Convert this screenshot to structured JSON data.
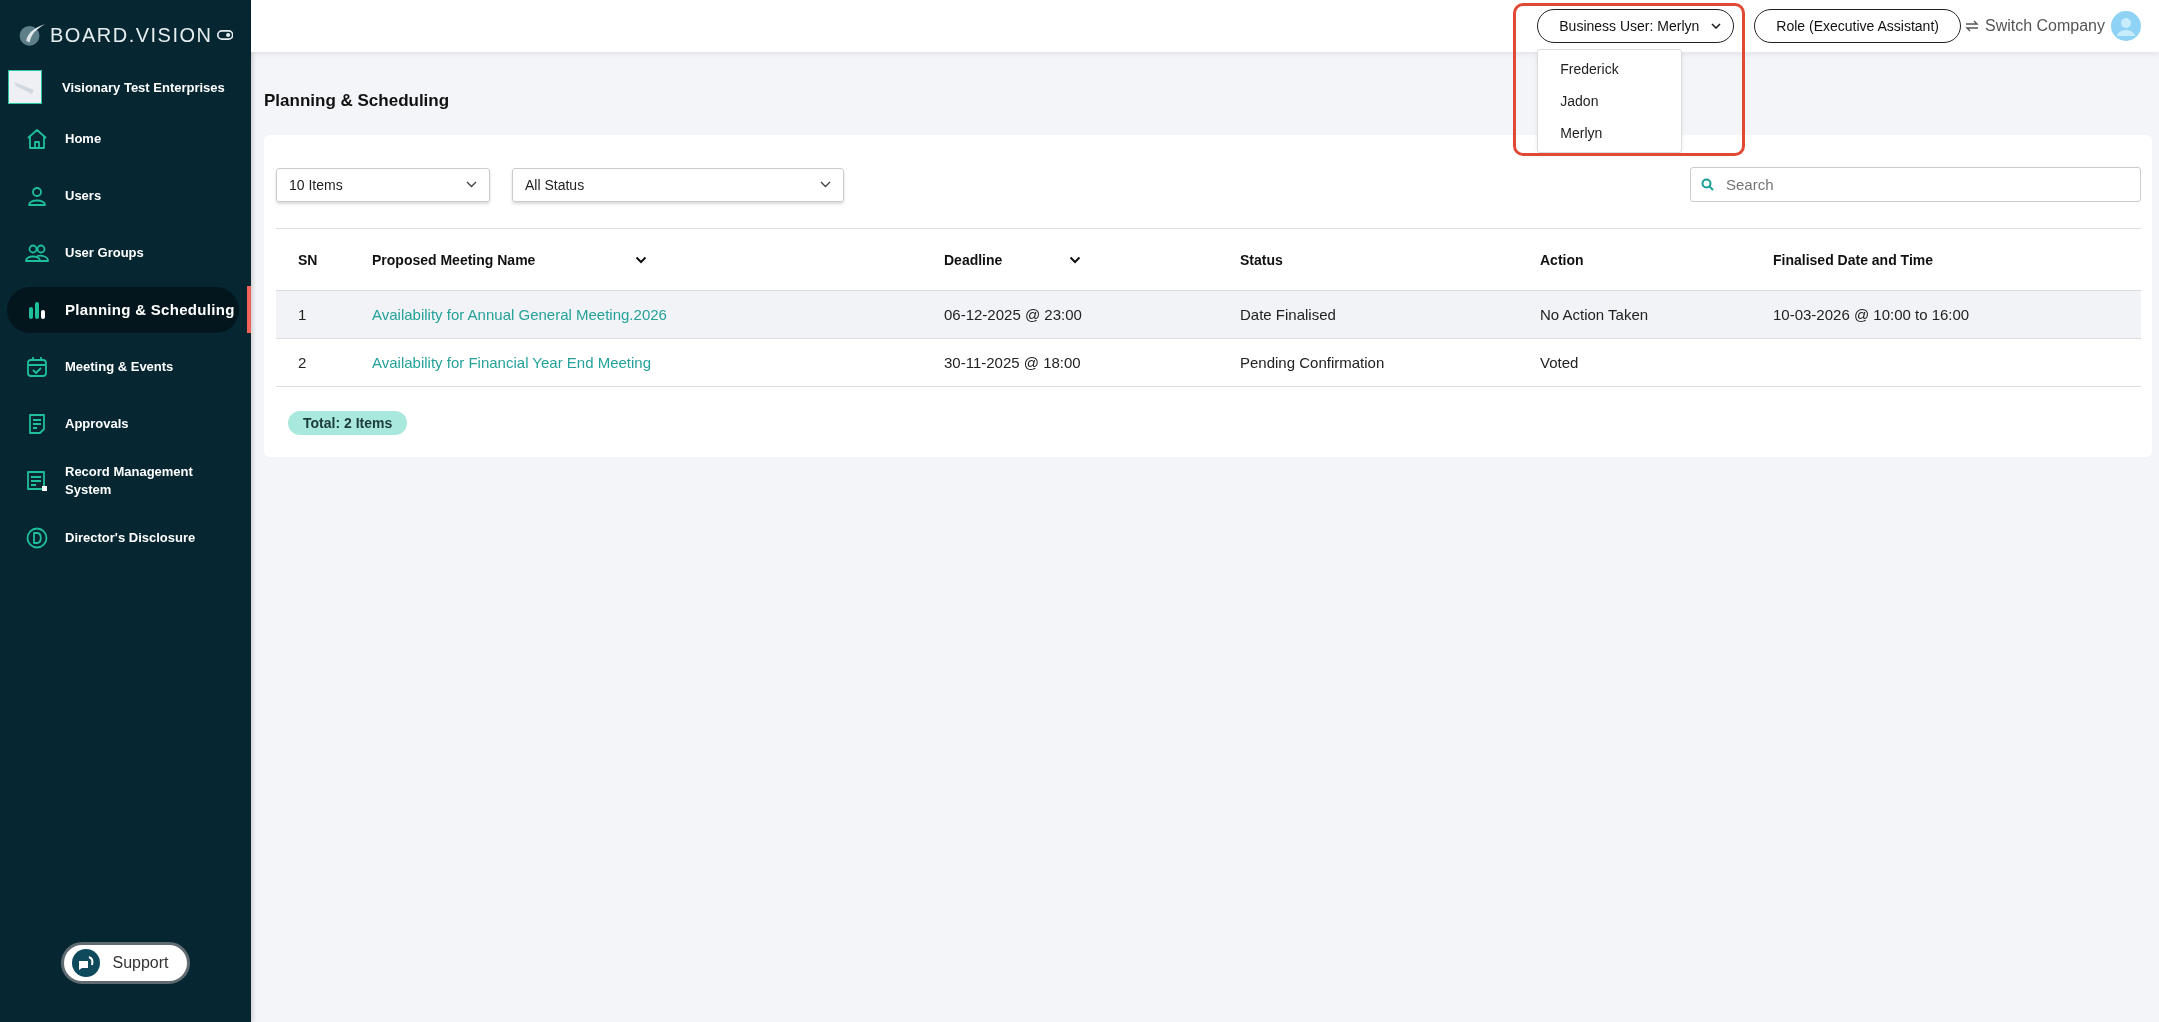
{
  "sidebar": {
    "logo_text": "BOARD.VISION",
    "company": "Visionary Test Enterprises",
    "items": [
      {
        "label": "Home",
        "selected": false
      },
      {
        "label": "Users",
        "selected": false
      },
      {
        "label": "User Groups",
        "selected": false
      },
      {
        "label": "Planning & Scheduling",
        "selected": true
      },
      {
        "label": "Meeting & Events",
        "selected": false
      },
      {
        "label": "Approvals",
        "selected": false
      },
      {
        "label": "Record Management System",
        "selected": false
      },
      {
        "label": "Director's Disclosure",
        "selected": false
      }
    ],
    "support": "Support"
  },
  "topbar": {
    "business_user": {
      "label": "Business User: Merlyn",
      "options": [
        "Frederick",
        "Jadon",
        "Merlyn"
      ]
    },
    "role": "Role (Executive Assistant)",
    "switch_company": "Switch Company"
  },
  "page_title": "Planning & Scheduling",
  "filters": {
    "page_size": "10 Items",
    "status": "All Status",
    "search": {
      "placeholder": "Search"
    }
  },
  "table": {
    "columns": [
      {
        "label": "SN",
        "sortable": false
      },
      {
        "label": "Proposed Meeting Name",
        "sortable": true
      },
      {
        "label": "Deadline",
        "sortable": true
      },
      {
        "label": "Status",
        "sortable": false
      },
      {
        "label": "Action",
        "sortable": false
      },
      {
        "label": "Finalised Date and Time",
        "sortable": false
      }
    ],
    "rows": [
      {
        "highlighted": true,
        "cells": [
          "1",
          "Availability for Annual General Meeting.2026",
          "06-12-2025 @ 23:00",
          "Date Finalised",
          "No Action Taken",
          "10-03-2026 @ 10:00 to 16:00"
        ]
      },
      {
        "highlighted": false,
        "cells": [
          "2",
          "Availability for Financial Year End Meeting",
          "30-11-2025 @ 18:00",
          "Pending Confirmation",
          "Voted"
        ]
      }
    ]
  },
  "total": "Total: 2 Items"
}
